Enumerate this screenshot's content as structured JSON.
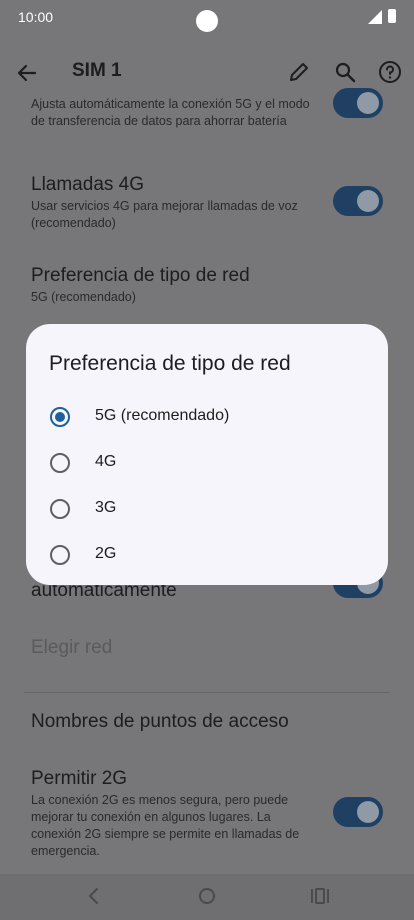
{
  "status": {
    "time": "10:00"
  },
  "appbar": {
    "title": "SIM 1"
  },
  "settings": {
    "auto5g_sub": "Ajusta automáticamente la conexión 5G y el modo de transferencia de datos para ahorrar batería",
    "calls4g_title": "Llamadas 4G",
    "calls4g_sub": "Usar servicios 4G para mejorar llamadas de voz (recomendado)",
    "netpref_title": "Preferencia de tipo de red",
    "netpref_sub": "5G (recomendado)",
    "auto_select_title": "automáticamente",
    "choose_network_title": "Elegir red",
    "apn_title": "Nombres de puntos de acceso",
    "allow2g_title": "Permitir 2G",
    "allow2g_sub": "La conexión 2G es menos segura, pero puede mejorar tu conexión en algunos lugares. La conexión 2G siempre se permite en llamadas de emergencia."
  },
  "dialog": {
    "title": "Preferencia de tipo de red",
    "options": [
      {
        "label": "5G (recomendado)",
        "selected": true
      },
      {
        "label": "4G",
        "selected": false
      },
      {
        "label": "3G",
        "selected": false
      },
      {
        "label": "2G",
        "selected": false
      }
    ]
  },
  "colors": {
    "accent": "#1e5f9c",
    "dialog_bg": "#f6f5fb",
    "scrim": "#777779"
  }
}
